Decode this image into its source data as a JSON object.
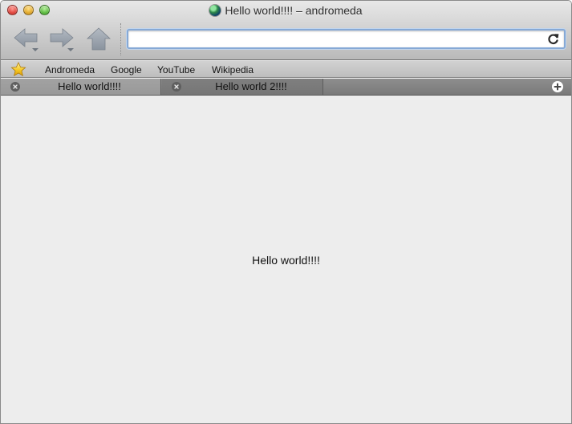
{
  "window": {
    "title": "Hello world!!!! – andromeda"
  },
  "toolbar": {
    "back_icon": "back-arrow-icon",
    "forward_icon": "forward-arrow-icon",
    "home_icon": "home-icon",
    "url_value": "",
    "url_placeholder": "",
    "reload_icon": "reload-icon"
  },
  "bookmarks": {
    "star_icon": "star-icon",
    "items": [
      {
        "label": "Andromeda"
      },
      {
        "label": "Google"
      },
      {
        "label": "YouTube"
      },
      {
        "label": "Wikipedia"
      }
    ]
  },
  "tabs": [
    {
      "label": "Hello world!!!!",
      "active": true
    },
    {
      "label": "Hello world 2!!!!",
      "active": false
    }
  ],
  "content": {
    "text": "Hello world!!!!"
  },
  "colors": {
    "content_bg": "#ededed",
    "urlbar_focus": "#86a9d6",
    "tabstrip": "#7a7a7a"
  }
}
